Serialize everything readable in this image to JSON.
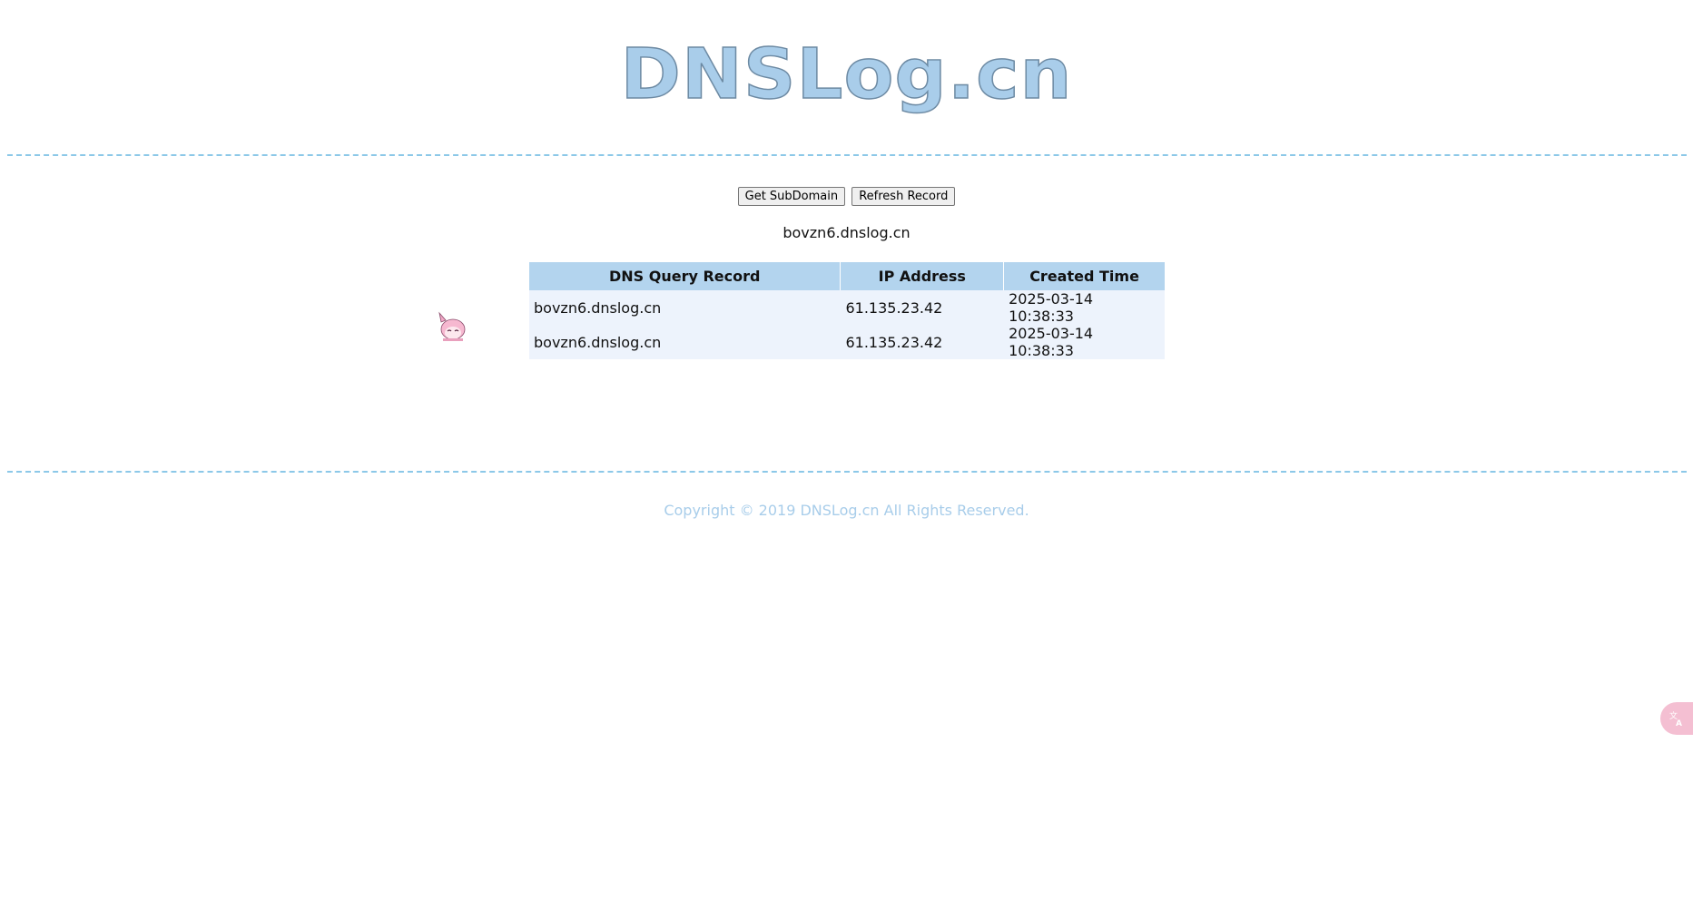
{
  "logo": {
    "text": "DNSLog.cn"
  },
  "toolbar": {
    "get_subdomain_label": "Get SubDomain",
    "refresh_record_label": "Refresh Record"
  },
  "subdomain": "bovzn6.dnslog.cn",
  "table": {
    "headers": [
      "DNS Query Record",
      "IP Address",
      "Created Time"
    ],
    "rows": [
      {
        "dns": "bovzn6.dnslog.cn",
        "ip": "61.135.23.42",
        "time": "2025-03-14 10:38:33"
      },
      {
        "dns": "bovzn6.dnslog.cn",
        "ip": "61.135.23.42",
        "time": "2025-03-14 10:38:33"
      }
    ]
  },
  "footer": {
    "copyright": "Copyright © 2019 DNSLog.cn All Rights Reserved."
  },
  "icons": {
    "mascot": "mascot-icon",
    "translate": "translate-icon"
  },
  "colors": {
    "divider": "#8cc8e8",
    "table_header": "#b3d4ee",
    "table_row": "#edf3fc",
    "copyright": "#a8cdea",
    "logo": "#a9cdea"
  }
}
